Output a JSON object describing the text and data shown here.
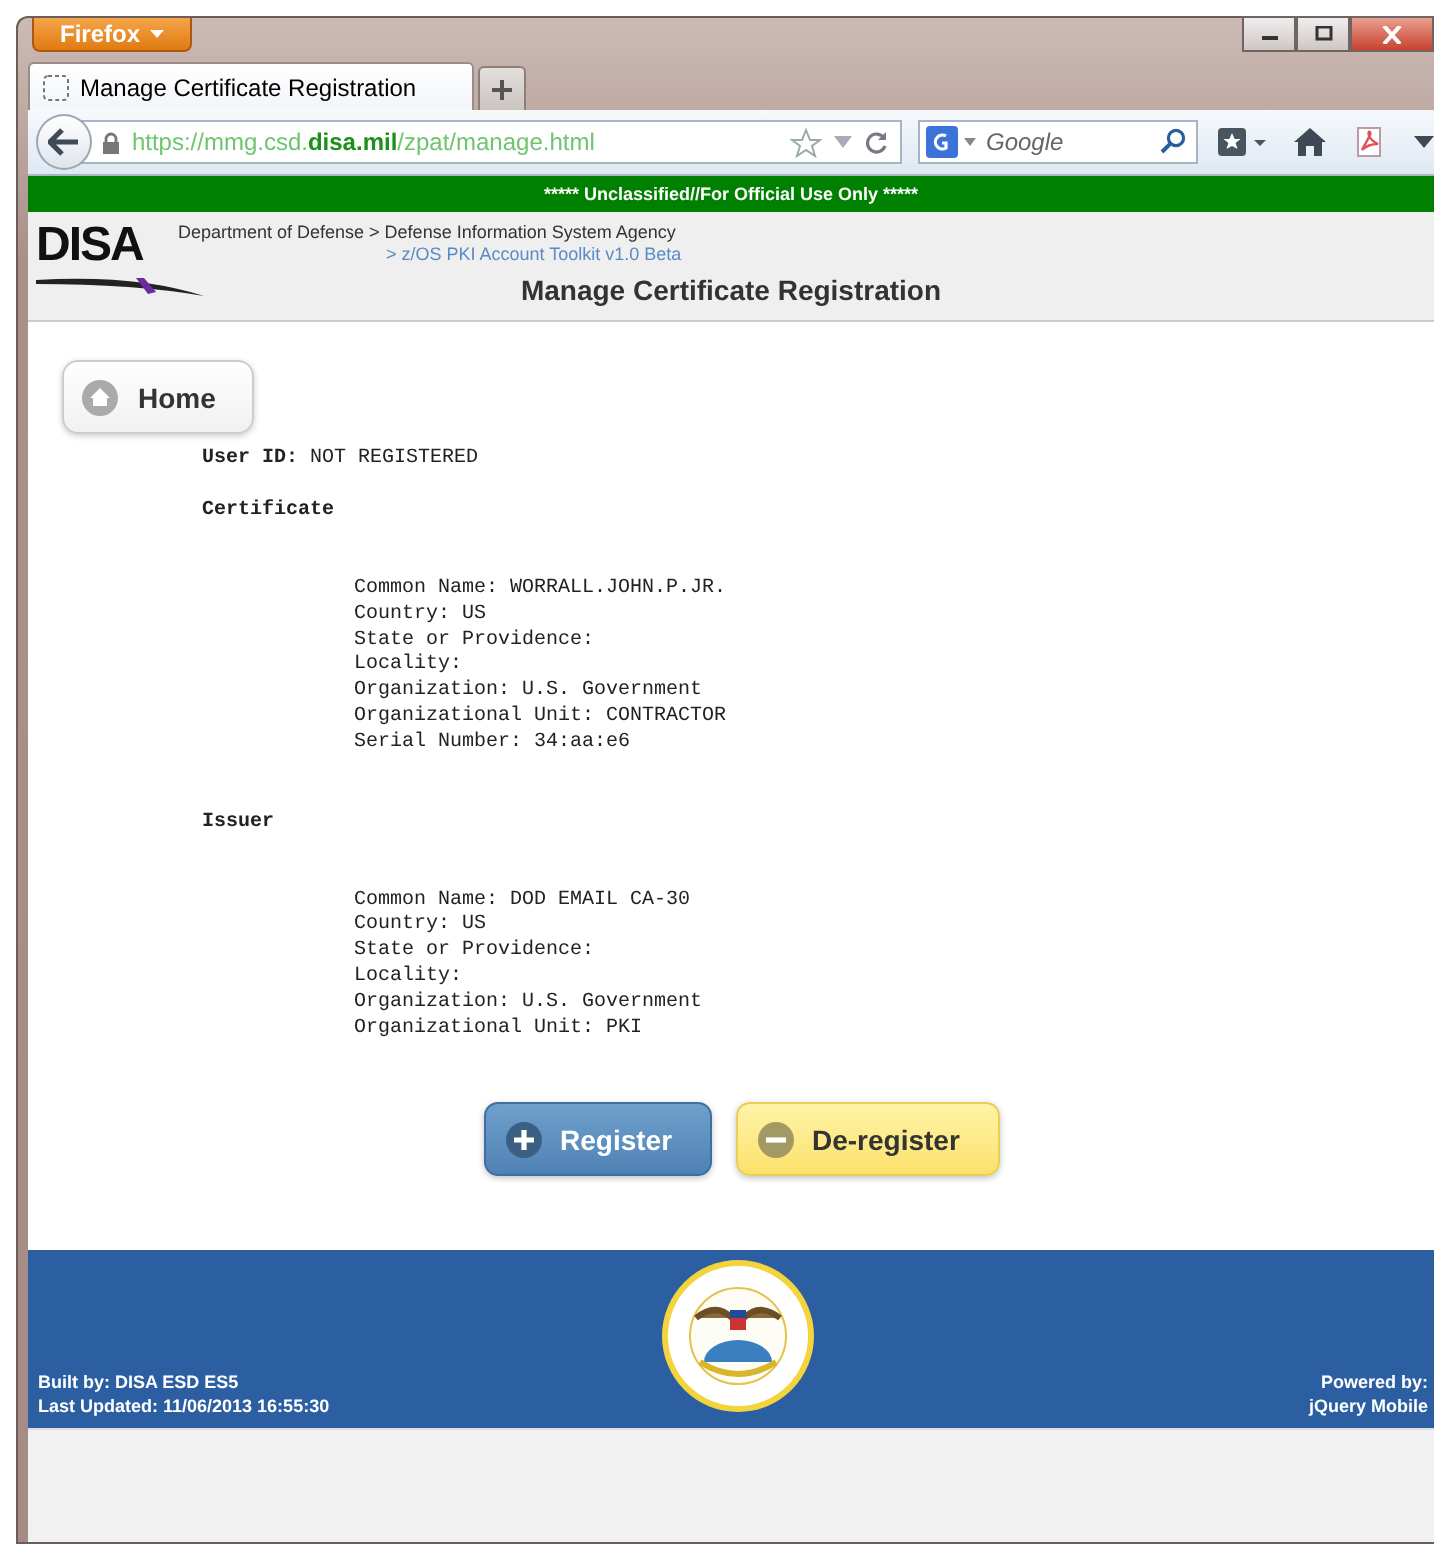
{
  "browser": {
    "menu_button": "Firefox",
    "tab_title": "Manage Certificate Registration",
    "url": "https://mmg.csd.**disa.mil**/zpat/manage.html",
    "search": {
      "placeholder": "Google"
    }
  },
  "banner": "***** Unclassified//For Official Use Only *****",
  "header": {
    "logo": "DISA",
    "breadcrumb": "Department of Defense > Defense Information System Agency",
    "sub_breadcrumb": "> z/OS PKI Account Toolkit v1.0 Beta",
    "title": "Manage Certificate Registration"
  },
  "home_button": "Home",
  "user_id": "**User ID:** NOT REGISTERED",
  "sections": [
    {
      "heading": "Certificate",
      "lines": [
        "Common Name: WORRALL.JOHN.P.JR.",
        "Country: US",
        "State or Providence:",
        "Locality:",
        "Organization: U.S. Government",
        "Organizational Unit: CONTRACTOR",
        "Serial Number: 34:aa:e6"
      ]
    },
    {
      "heading": "Issuer",
      "lines": [
        "Common Name: DOD EMAIL CA-30",
        "Country: US",
        "State or Providence:",
        "Locality:",
        "Organization: U.S. Government",
        "Organizational Unit: PKI"
      ]
    }
  ],
  "actions": [
    {
      "label": "Register",
      "kind": "add"
    },
    {
      "label": "De-register",
      "kind": "remove"
    }
  ],
  "footer": {
    "built_by": "Built by: DISA ESD ES5",
    "last_updated": "Last Updated: 11/06/2013 16:55:30",
    "powered_by": "Powered by:",
    "powered_by_name": "jQuery Mobile"
  }
}
